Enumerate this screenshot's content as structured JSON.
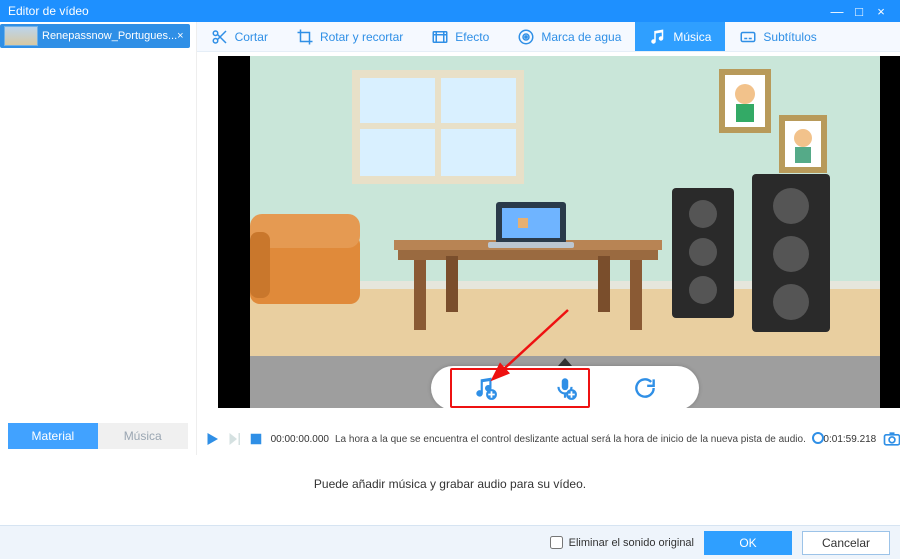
{
  "window": {
    "title": "Editor de vídeo"
  },
  "file_tab": {
    "name": "Renepassnow_Portugues...",
    "close": "×"
  },
  "sidebar_tabs": {
    "material": "Material",
    "music": "Música"
  },
  "toolbar": {
    "cut": "Cortar",
    "rotate": "Rotar y recortar",
    "effect": "Efecto",
    "watermark": "Marca de agua",
    "music": "Música",
    "subtitle": "Subtítulos"
  },
  "timeline": {
    "start": "00:00:00.000",
    "end": "00:01:59.218",
    "slider_hint": "La hora a la que se encuentra el control deslizante actual será la hora de inicio de la nueva pista de audio."
  },
  "hint": "Puede añadir música y grabar audio para su vídeo.",
  "footer": {
    "remove_original": "Eliminar el sonido original",
    "ok": "OK",
    "cancel": "Cancelar"
  },
  "icons": {
    "add_music": "add-music-icon",
    "add_voice": "add-voice-icon",
    "refresh": "refresh-icon"
  }
}
